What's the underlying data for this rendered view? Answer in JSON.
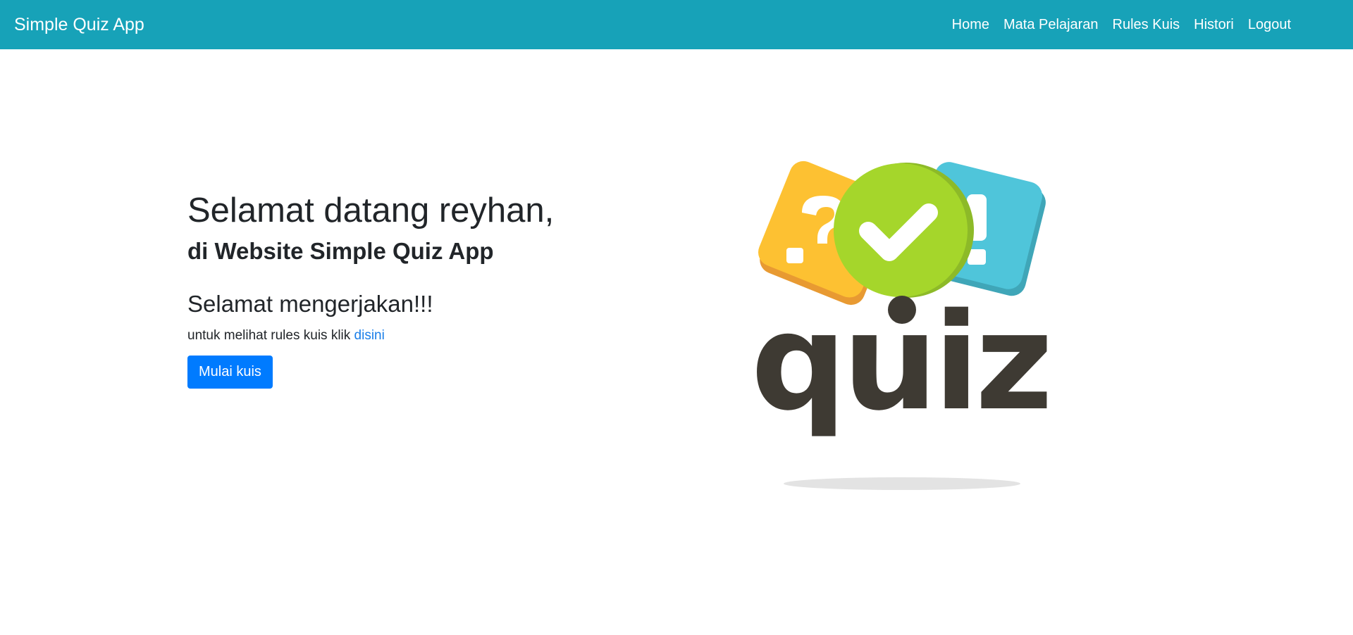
{
  "navbar": {
    "brand": "Simple Quiz App",
    "links": [
      "Home",
      "Mata Pelajaran",
      "Rules Kuis",
      "Histori",
      "Logout"
    ],
    "background": "#17a2b8"
  },
  "hero": {
    "welcome": "Selamat datang reyhan,",
    "subtitle_prefix": "di Website",
    "subtitle_app": "Simple Quiz App",
    "greeting": "Selamat mengerjakan!!!",
    "rules_text": "untuk melihat rules kuis klik",
    "rules_link": "disini",
    "start_button": "Mulai kuis",
    "button_color": "#007bff",
    "link_color": "#1a7ee8"
  },
  "illustration": {
    "word": "quiz",
    "icons": [
      "question-mark-icon",
      "checkmark-icon",
      "exclamation-icon"
    ],
    "colors": {
      "yellow": "#fdc132",
      "green": "#a5d62b",
      "blue": "#4fc5da",
      "text": "#3e3a33"
    }
  }
}
